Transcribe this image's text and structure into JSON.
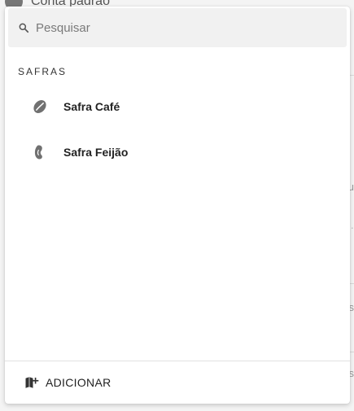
{
  "background": {
    "header_title": "Conta padrão"
  },
  "search": {
    "placeholder": "Pesquisar",
    "value": ""
  },
  "section": {
    "title": "SAFRAS",
    "items": [
      {
        "label": "Safra Café",
        "icon": "coffee-bean-icon"
      },
      {
        "label": "Safra Feijão",
        "icon": "bean-icon"
      }
    ]
  },
  "footer": {
    "add_label": "ADICIONAR",
    "icon": "add-map-icon"
  }
}
